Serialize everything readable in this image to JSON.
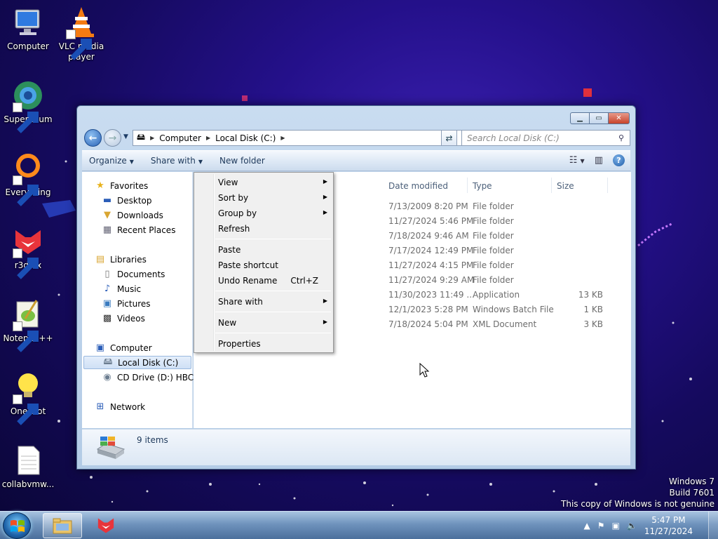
{
  "desktop": {
    "icons": [
      {
        "label": "Computer"
      },
      {
        "label": "VLC media player"
      },
      {
        "label": "Supermium"
      },
      {
        "label": "Everything"
      },
      {
        "label": "r3dfox"
      },
      {
        "label": "Notepad++"
      },
      {
        "label": "Oneshot"
      },
      {
        "label": "collabvmw..."
      }
    ],
    "watermark": {
      "line1": "Windows 7",
      "line2": "Build 7601",
      "line3": "This copy of Windows is not genuine"
    }
  },
  "explorer": {
    "address": {
      "segments": [
        "Computer",
        "Local Disk (C:)"
      ]
    },
    "search": {
      "placeholder": "Search Local Disk (C:)"
    },
    "toolbar": {
      "organize": "Organize",
      "share_with": "Share with",
      "new_folder": "New folder"
    },
    "nav": {
      "favorites": "Favorites",
      "desktop": "Desktop",
      "downloads": "Downloads",
      "recent_places": "Recent Places",
      "libraries": "Libraries",
      "documents": "Documents",
      "music": "Music",
      "pictures": "Pictures",
      "videos": "Videos",
      "computer": "Computer",
      "local_disk": "Local Disk (C:)",
      "cd_drive": "CD Drive (D:) HBCD_",
      "network": "Network"
    },
    "columns": {
      "date_modified": "Date modified",
      "type": "Type",
      "size": "Size"
    },
    "rows": [
      {
        "date": "7/13/2009 8:20 PM",
        "type": "File folder",
        "size": ""
      },
      {
        "date": "11/27/2024 5:46 PM",
        "type": "File folder",
        "size": ""
      },
      {
        "date": "7/18/2024 9:46 AM",
        "type": "File folder",
        "size": ""
      },
      {
        "date": "7/17/2024 12:49 PM",
        "type": "File folder",
        "size": ""
      },
      {
        "date": "11/27/2024 4:15 PM",
        "type": "File folder",
        "size": ""
      },
      {
        "date": "11/27/2024 9:29 AM",
        "type": "File folder",
        "size": ""
      },
      {
        "date": "11/30/2023 11:49 ...",
        "type": "Application",
        "size": "13 KB"
      },
      {
        "date": "12/1/2023 5:28 PM",
        "type": "Windows Batch File",
        "size": "1 KB"
      },
      {
        "date": "7/18/2024 5:04 PM",
        "type": "XML Document",
        "size": "3 KB"
      }
    ],
    "details": {
      "count": "9 items"
    }
  },
  "context_menu": {
    "view": "View",
    "sort_by": "Sort by",
    "group_by": "Group by",
    "refresh": "Refresh",
    "paste": "Paste",
    "paste_shortcut": "Paste shortcut",
    "undo_rename": "Undo Rename",
    "undo_shortcut": "Ctrl+Z",
    "share_with": "Share with",
    "new": "New",
    "properties": "Properties"
  },
  "taskbar": {
    "time": "5:47 PM",
    "date": "11/27/2024"
  },
  "colors": {
    "desktop_bg": "#1a0c6e",
    "taskbar": "#6f93bd",
    "window_frame": "#b3cbe6"
  }
}
